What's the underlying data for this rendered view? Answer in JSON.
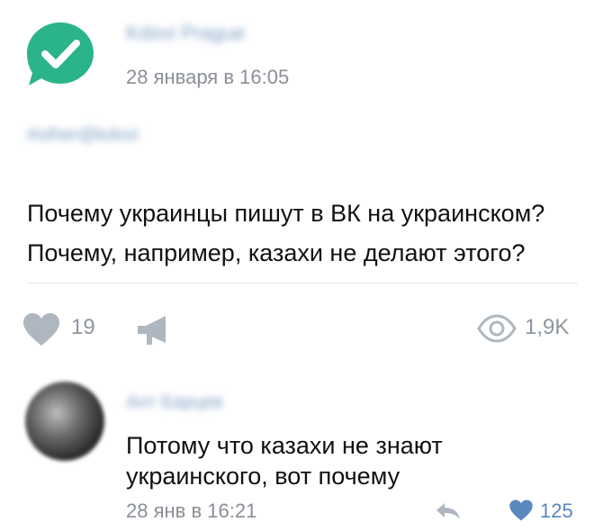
{
  "post": {
    "author_name": "Kdovi Prague",
    "timestamp": "28 января в 16:05",
    "tag": "#other@kdovi",
    "text_line1": "Почему украинцы пишут в ВК на украинском?",
    "text_line2": "Почему, например, казахи не делают этого?",
    "likes": "19",
    "views": "1,9K",
    "avatar_icon": "checkmark-icon",
    "avatar_color": "#2bb38a"
  },
  "comment": {
    "author_name": "Ант Барцев",
    "text_line1": "Потому что казахи не знают",
    "text_line2": "украинского, вот почему",
    "timestamp": "28 янв в 16:21",
    "likes": "125",
    "like_color": "#5b88bd"
  }
}
